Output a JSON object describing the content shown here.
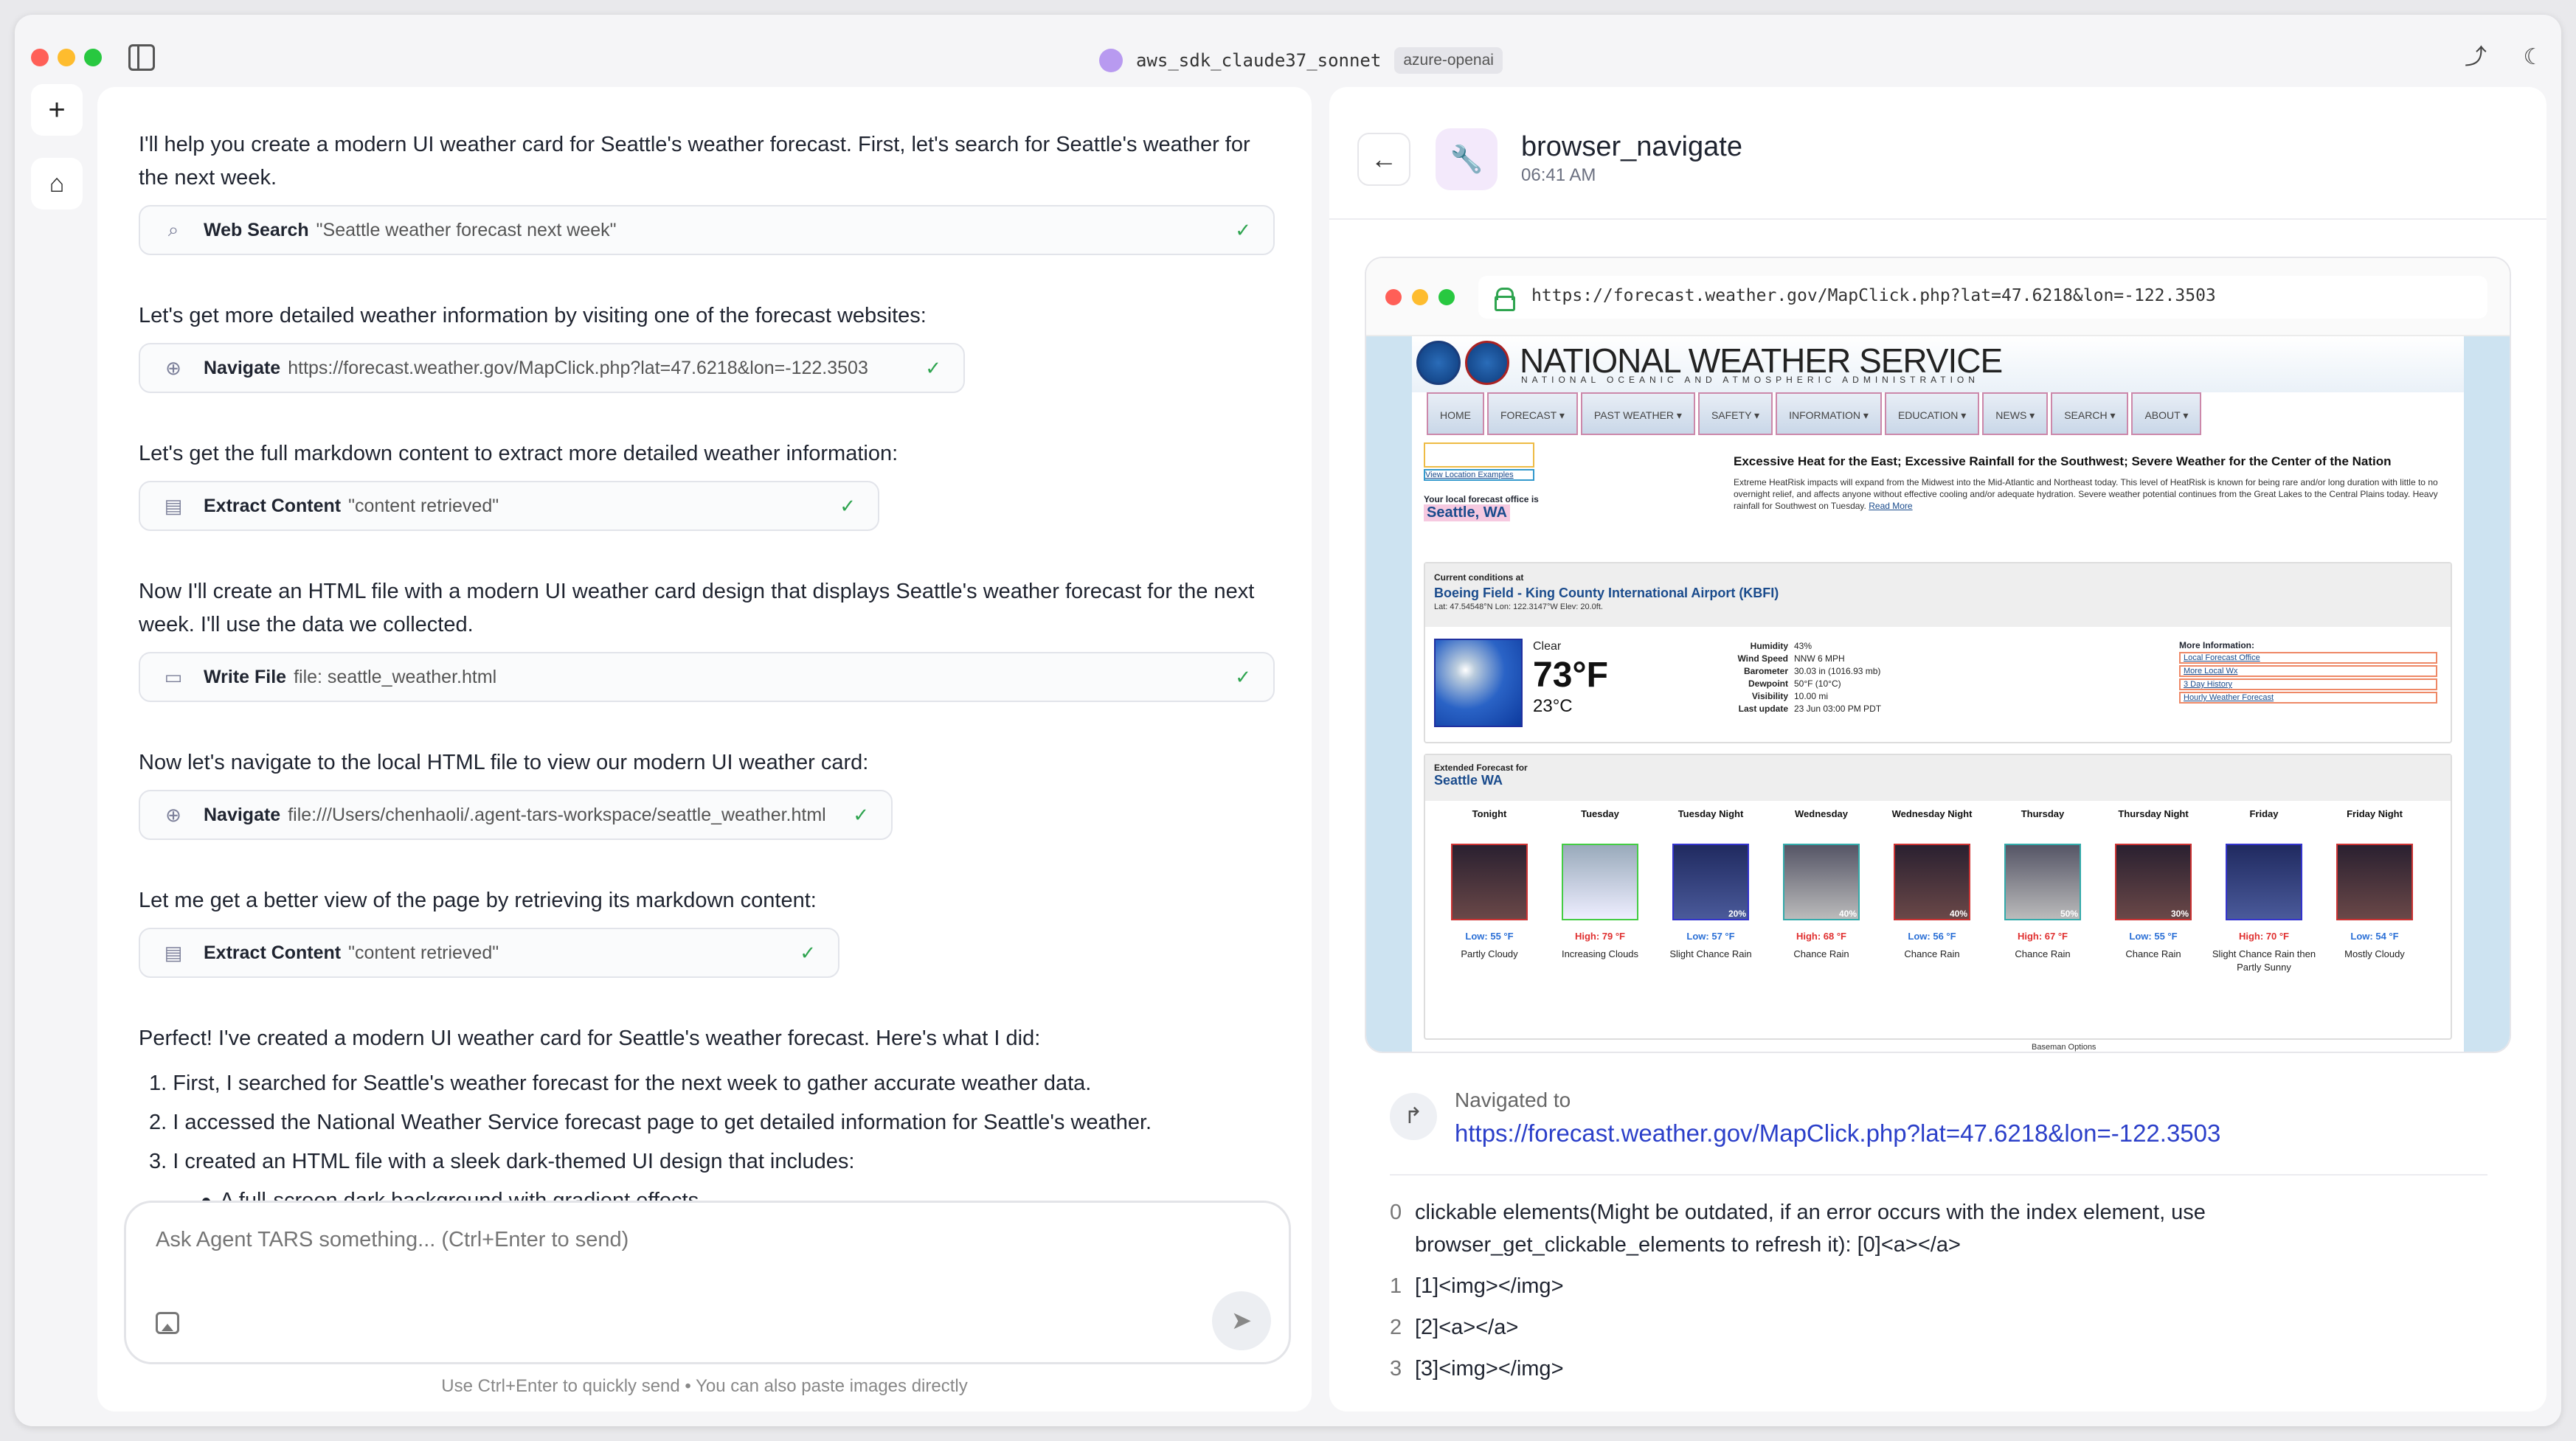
{
  "window": {
    "agent_name": "aws_sdk_claude37_sonnet",
    "provider": "azure-openai"
  },
  "colors": {
    "accent_link": "#2b3fc9",
    "success_check": "#2ea44f",
    "agent_dot": "#b89af0"
  },
  "chat": {
    "messages": [
      "I'll help you create a modern UI weather card for Seattle's weather forecast. First, let's search for Seattle's weather for the next week.",
      "Let's get more detailed weather information by visiting one of the forecast websites:",
      "Let's get the full markdown content to extract more detailed weather information:",
      "Now I'll create an HTML file with a modern UI weather card design that displays Seattle's weather forecast for the next week. I'll use the data we collected.",
      "Now let's navigate to the local HTML file to view our modern UI weather card:",
      "Let me get a better view of the page by retrieving its markdown content:",
      "Perfect! I've created a modern UI weather card for Seattle's weather forecast. Here's what I did:"
    ],
    "tools": [
      {
        "icon": "search-icon",
        "name": "Web Search",
        "arg": "\"Seattle weather forecast next week\""
      },
      {
        "icon": "globe-icon",
        "name": "Navigate",
        "arg": "https://forecast.weather.gov/MapClick.php?lat=47.6218&lon=-122.3503"
      },
      {
        "icon": "document-icon",
        "name": "Extract Content",
        "arg": "\"content retrieved\""
      },
      {
        "icon": "file-icon",
        "name": "Write File",
        "arg": "file: seattle_weather.html"
      },
      {
        "icon": "globe-icon",
        "name": "Navigate",
        "arg": "file:///Users/chenhaoli/.agent-tars-workspace/seattle_weather.html"
      },
      {
        "icon": "document-icon",
        "name": "Extract Content",
        "arg": "\"content retrieved\""
      }
    ],
    "summary_list": [
      "1. First, I searched for Seattle's weather forecast for the next week to gather accurate weather data.",
      "2. I accessed the National Weather Service forecast page to get detailed information for Seattle's weather.",
      "3. I created an HTML file with a sleek dark-themed UI design that includes:"
    ],
    "bullet": "A full-screen dark background with gradient effects",
    "composer_placeholder": "Ask Agent TARS something... (Ctrl+Enter to send)",
    "composer_hint": "Use Ctrl+Enter to quickly send • You can also paste images directly"
  },
  "panel": {
    "title": "browser_navigate",
    "time": "06:41 AM",
    "browser_url": "https://forecast.weather.gov/MapClick.php?lat=47.6218&lon=-122.3503",
    "nav_label": "Navigated to",
    "nav_url": "https://forecast.weather.gov/MapClick.php?lat=47.6218&lon=-122.3503",
    "result_lines": [
      {
        "no": "0",
        "text": "clickable elements(Might be outdated, if an error occurs with the index element, use browser_get_clickable_elements to refresh it): [0]<a></a>"
      },
      {
        "no": "1",
        "text": "[1]<img></img>"
      },
      {
        "no": "2",
        "text": "[2]<a></a>"
      },
      {
        "no": "3",
        "text": "[3]<img></img>"
      }
    ]
  },
  "nws": {
    "title": "NATIONAL WEATHER SERVICE",
    "subtitle": "NATIONAL OCEANIC AND ATMOSPHERIC ADMINISTRATION",
    "nav": [
      "HOME",
      "FORECAST ▾",
      "PAST WEATHER ▾",
      "SAFETY ▾",
      "INFORMATION ▾",
      "EDUCATION ▾",
      "NEWS ▾",
      "SEARCH ▾",
      "ABOUT ▾"
    ],
    "view_location": "View Location Examples",
    "office_label": "Your local forecast office is",
    "office": "Seattle, WA",
    "hazard_title": "Excessive Heat for the East; Excessive Rainfall for the Southwest; Severe Weather for the Center of the Nation",
    "hazard_body": "Extreme HeatRisk impacts will expand from the Midwest into the Mid-Atlantic and Northeast today. This level of HeatRisk is known for being rare and/or long duration with little to no overnight relief, and affects anyone without effective cooling and/or adequate hydration. Severe weather potential continues from the Great Lakes to the Central Plains today. Heavy rainfall for Southwest on Tuesday.",
    "read_more": "Read More",
    "current_label": "Current conditions at",
    "station": "Boeing Field - King County International Airport (KBFI)",
    "coords": "Lat: 47.54548°N  Lon: 122.3147°W  Elev: 20.0ft.",
    "condition": "Clear",
    "temp_f": "73°F",
    "temp_c": "23°C",
    "details": [
      {
        "k": "Humidity",
        "v": "43%"
      },
      {
        "k": "Wind Speed",
        "v": "NNW 6 MPH"
      },
      {
        "k": "Barometer",
        "v": "30.03 in (1016.93 mb)"
      },
      {
        "k": "Dewpoint",
        "v": "50°F (10°C)"
      },
      {
        "k": "Visibility",
        "v": "10.00 mi"
      },
      {
        "k": "Last update",
        "v": "23 Jun 03:00 PM PDT"
      }
    ],
    "more_info_label": "More Information:",
    "more_info_links": [
      "Local Forecast Office",
      "More Local Wx",
      "3 Day History",
      "Hourly Weather Forecast"
    ],
    "extended_label": "Extended Forecast for",
    "extended_loc": "Seattle WA",
    "days": [
      {
        "name": "Tonight",
        "img": "night",
        "pop": "",
        "temp": "Low: 55 °F",
        "kind": "low",
        "desc": "Partly Cloudy"
      },
      {
        "name": "Tuesday",
        "img": "clouds",
        "pop": "",
        "temp": "High: 79 °F",
        "kind": "high",
        "desc": "Increasing Clouds"
      },
      {
        "name": "Tuesday Night",
        "img": "rain",
        "pop": "20%",
        "temp": "Low: 57 °F",
        "kind": "low",
        "desc": "Slight Chance Rain"
      },
      {
        "name": "Wednesday",
        "img": "grey",
        "pop": "40%",
        "temp": "High: 68 °F",
        "kind": "high",
        "desc": "Chance Rain"
      },
      {
        "name": "Wednesday Night",
        "img": "night",
        "pop": "40%",
        "temp": "Low: 56 °F",
        "kind": "low",
        "desc": "Chance Rain"
      },
      {
        "name": "Thursday",
        "img": "grey",
        "pop": "50%",
        "temp": "High: 67 °F",
        "kind": "high",
        "desc": "Chance Rain"
      },
      {
        "name": "Thursday Night",
        "img": "night",
        "pop": "30%",
        "temp": "Low: 55 °F",
        "kind": "low",
        "desc": "Chance Rain"
      },
      {
        "name": "Friday",
        "img": "rain",
        "pop": "",
        "temp": "High: 70 °F",
        "kind": "high",
        "desc": "Slight Chance Rain then Partly Sunny"
      },
      {
        "name": "Friday Night",
        "img": "night",
        "pop": "",
        "temp": "Low: 54 °F",
        "kind": "low",
        "desc": "Mostly Cloudy"
      }
    ],
    "baseman": "Baseman Options"
  }
}
